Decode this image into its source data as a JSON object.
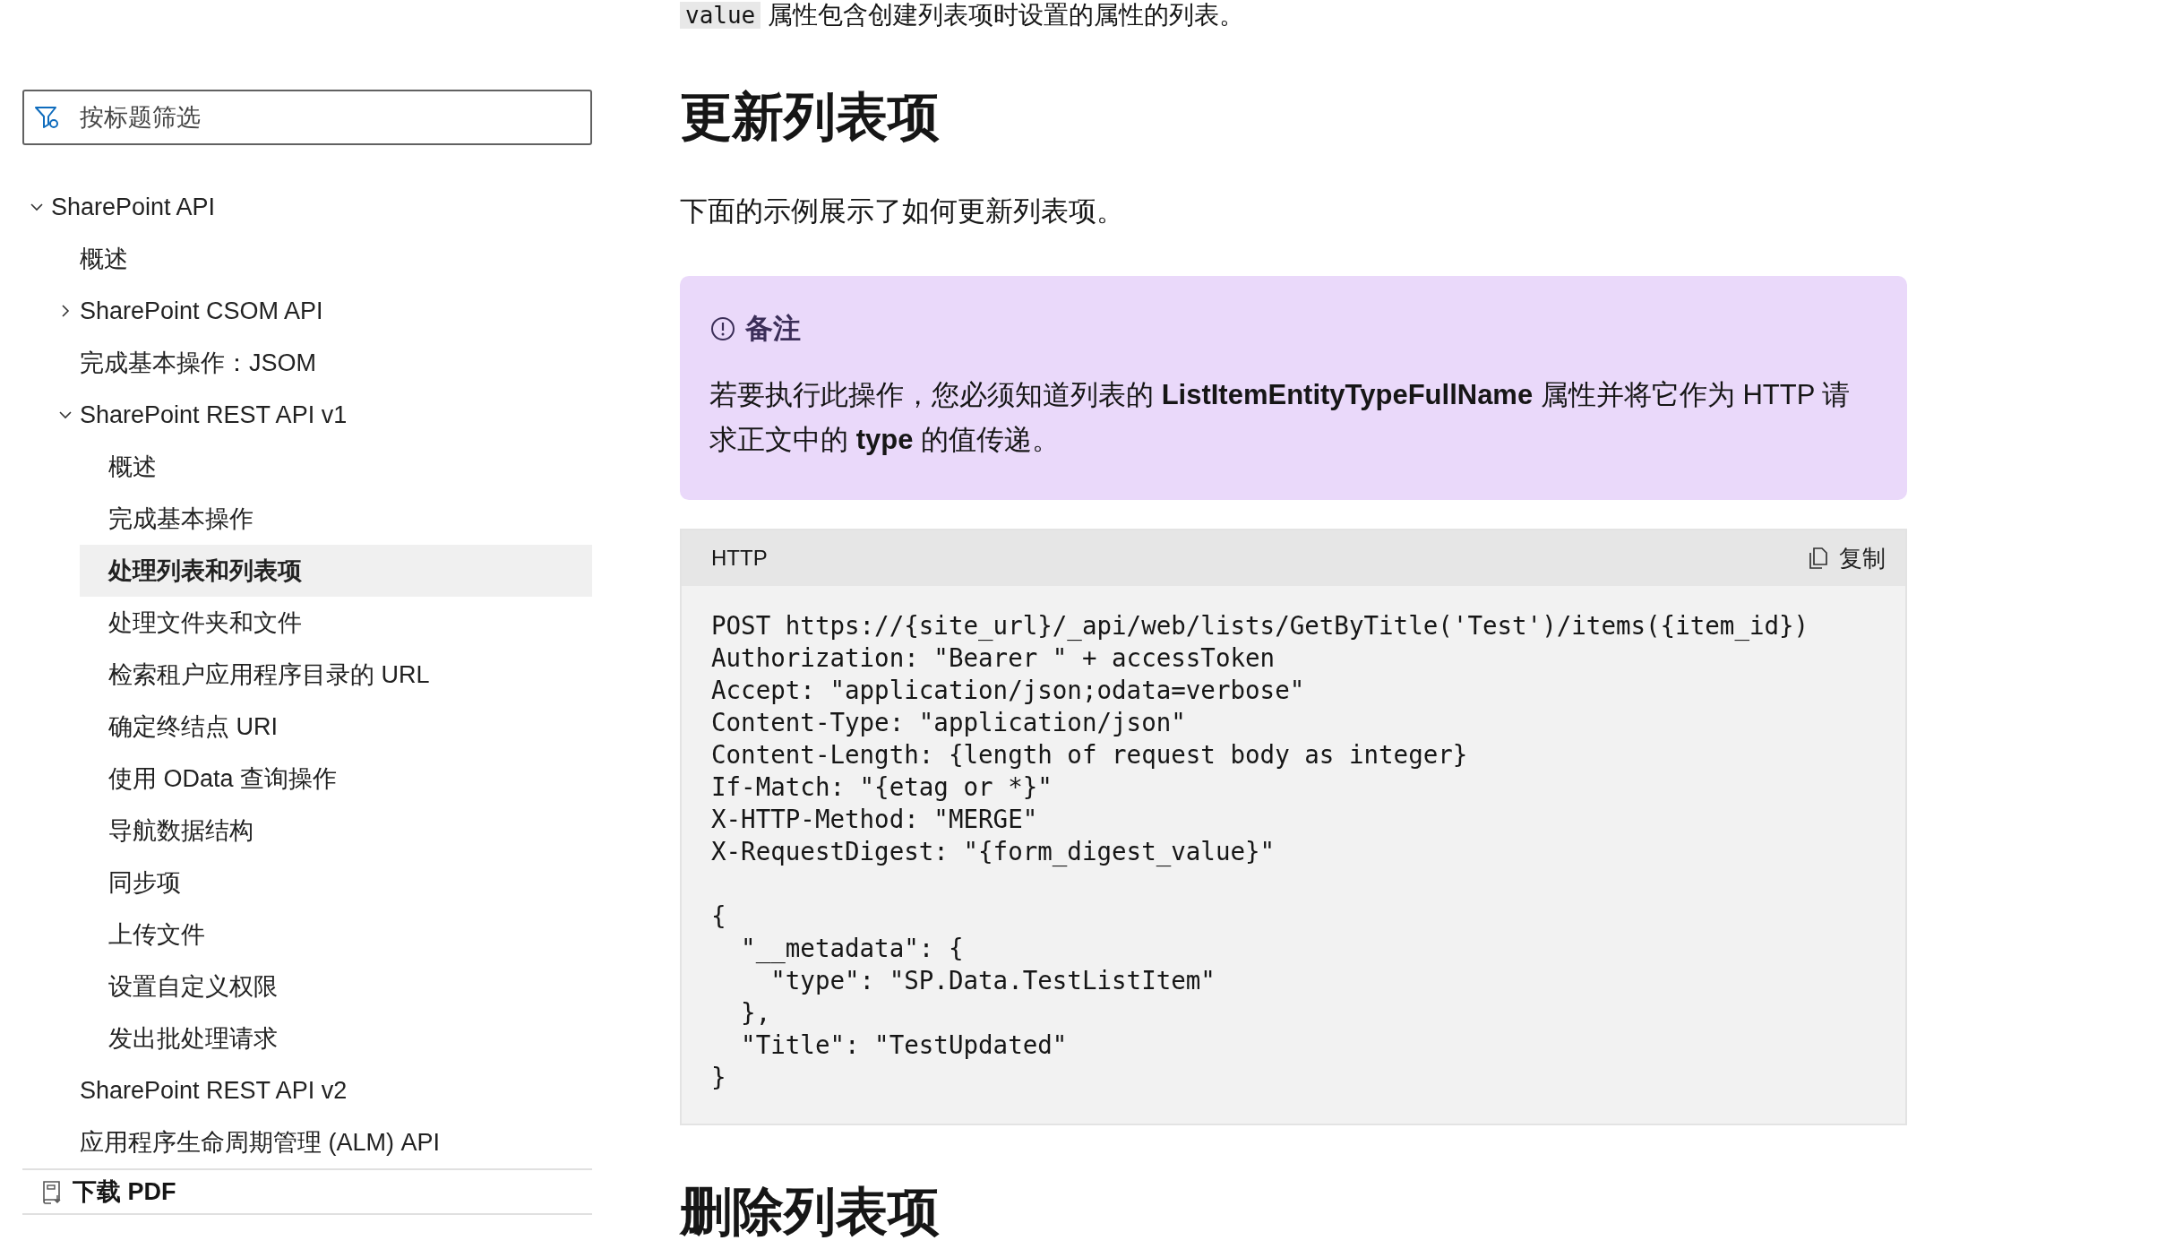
{
  "top_text": {
    "code": "value",
    "text": " 属性包含创建列表项时设置的属性的列表。"
  },
  "sidebar": {
    "filter": {
      "placeholder": "按标题筛选"
    },
    "tree": [
      {
        "label": "SharePoint API",
        "expanded": true,
        "selected": false,
        "children": [
          {
            "label": "概述",
            "selected": false
          },
          {
            "label": "SharePoint CSOM API",
            "expanded": false,
            "selected": false
          },
          {
            "label": "完成基本操作：JSOM",
            "selected": false
          },
          {
            "label": "SharePoint REST API v1",
            "expanded": true,
            "selected": false,
            "children": [
              {
                "label": "概述",
                "selected": false
              },
              {
                "label": "完成基本操作",
                "selected": false
              },
              {
                "label": "处理列表和列表项",
                "selected": true
              },
              {
                "label": "处理文件夹和文件",
                "selected": false
              },
              {
                "label": "检索租户应用程序目录的 URL",
                "selected": false
              },
              {
                "label": "确定终结点 URI",
                "selected": false
              },
              {
                "label": "使用 OData 查询操作",
                "selected": false
              },
              {
                "label": "导航数据结构",
                "selected": false
              },
              {
                "label": "同步项",
                "selected": false
              },
              {
                "label": "上传文件",
                "selected": false
              },
              {
                "label": "设置自定义权限",
                "selected": false
              },
              {
                "label": "发出批处理请求",
                "selected": false
              }
            ]
          },
          {
            "label": "SharePoint REST API v2",
            "selected": false
          },
          {
            "label": "应用程序生命周期管理 (ALM) API",
            "selected": false
          }
        ]
      }
    ],
    "download": "下载 PDF"
  },
  "article": [
    {
      "kind": "heading",
      "text": "更新列表项"
    },
    {
      "kind": "paragraph",
      "text": "下面的示例展示了如何更新列表项。"
    },
    {
      "kind": "note",
      "title": "备注",
      "text": "若要执行此操作，您必须知道列表的 **ListItemEntityTypeFullName** 属性并将它作为 HTTP 请求正文中的 **type** 的值传递。"
    },
    {
      "kind": "code",
      "language": "HTTP",
      "copy": "复制",
      "code": "POST https://{site_url}/_api/web/lists/GetByTitle('Test')/items({item_id})\nAuthorization: \"Bearer \" + accessToken\nAccept: \"application/json;odata=verbose\"\nContent-Type: \"application/json\"\nContent-Length: {length of request body as integer}\nIf-Match: \"{etag or *}\"\nX-HTTP-Method: \"MERGE\"\nX-RequestDigest: \"{form_digest_value}\"\n\n{\n  \"__metadata\": {\n    \"type\": \"SP.Data.TestListItem\"\n  },\n  \"Title\": \"TestUpdated\"\n}"
    },
    {
      "kind": "heading",
      "text": "删除列表项"
    }
  ]
}
